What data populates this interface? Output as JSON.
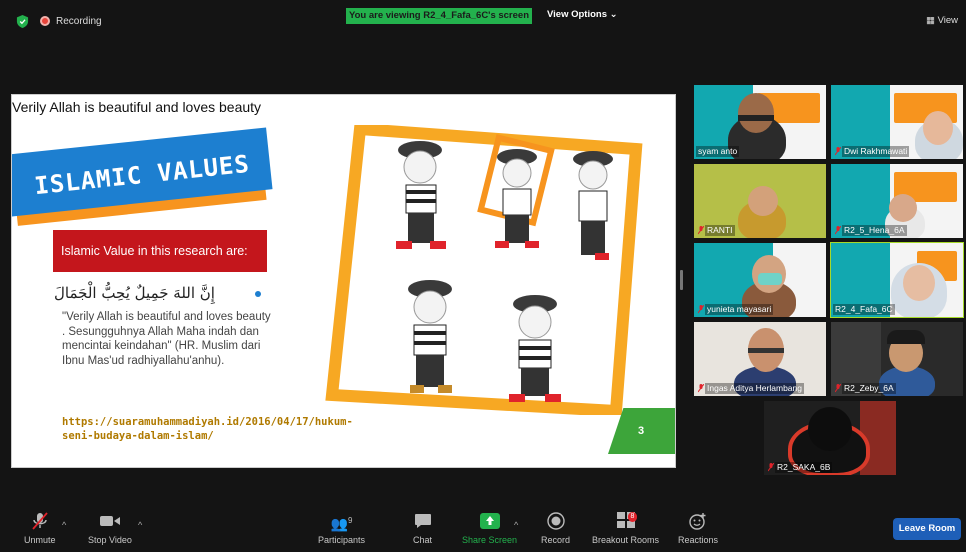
{
  "meeting": {
    "recording_label": "Recording",
    "viewing_banner": "You are viewing R2_4_Fafa_6C's screen",
    "view_options_label": "View Options",
    "view_label": "View"
  },
  "slide": {
    "caption": "Verily Allah is beautiful and loves beauty",
    "title": "ISLAMIC VALUES",
    "value_box": "Islamic Value in this research are:",
    "arabic": "إِنَّ اللهَ جَمِيلٌ يُحِبُّ الْجَمَالَ",
    "quote": "\"Verily Allah is beautiful and loves beauty . Sesungguhnya Allah Maha indah dan mencintai keindahan\" (HR. Muslim dari Ibnu Mas'ud radhiyallahu'anhu).",
    "link": "https://suaramuhammadiyah.id/2016/04/17/hukum-seni-budaya-dalam-islam/",
    "page_number": "3"
  },
  "participants": [
    {
      "name": "syam anto",
      "muted": false
    },
    {
      "name": "Dwi Rakhmawati",
      "muted": true
    },
    {
      "name": "RANTI",
      "muted": true
    },
    {
      "name": "R2_5_Hena_6A",
      "muted": true
    },
    {
      "name": "yunieta mayasari",
      "muted": true
    },
    {
      "name": "R2_4_Fafa_6C",
      "muted": false
    },
    {
      "name": "Ingas Aditya Herlambang",
      "muted": true
    },
    {
      "name": "R2_Zeby_6A",
      "muted": true
    },
    {
      "name": "R2_SAKA_6B",
      "muted": true
    }
  ],
  "toolbar": {
    "unmute": "Unmute",
    "stop_video": "Stop Video",
    "participants": "Participants",
    "participants_count": "9",
    "chat": "Chat",
    "share_screen": "Share Screen",
    "record": "Record",
    "breakout_rooms": "Breakout Rooms",
    "breakout_badge": "8",
    "reactions": "Reactions",
    "leave_room": "Leave Room"
  },
  "colors": {
    "share_green": "#23b14d",
    "leave_blue": "#1e5fb8",
    "active_speaker": "#a6d929",
    "title_blue": "#1d7fd0",
    "title_orange": "#f7941e",
    "value_red": "#c4161c"
  },
  "icons": [
    "shield-icon",
    "record-dot-icon",
    "chevron-down-icon",
    "grid-view-icon",
    "muted-mic-icon",
    "video-camera-icon",
    "participants-icon",
    "chat-icon",
    "share-screen-icon",
    "record-icon",
    "breakout-rooms-icon",
    "reactions-icon"
  ]
}
